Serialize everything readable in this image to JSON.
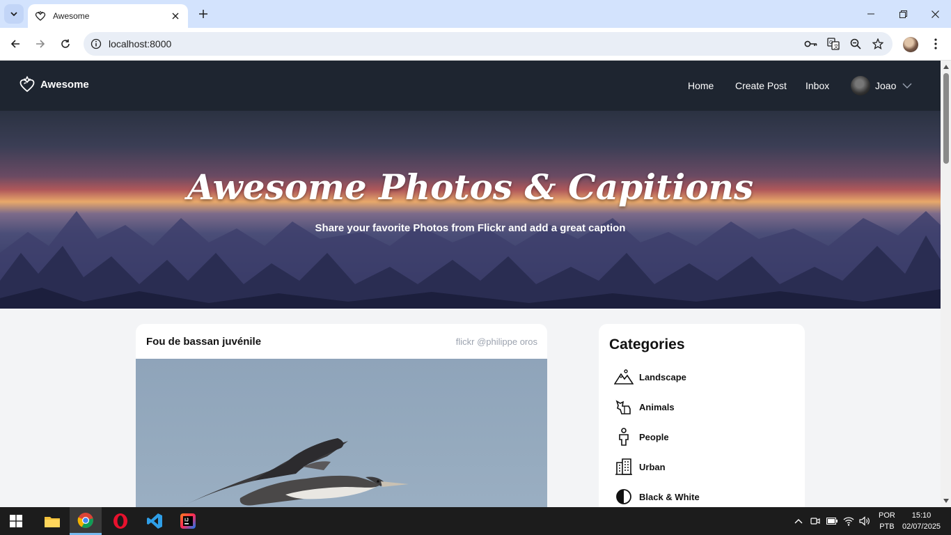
{
  "browser": {
    "tab_title": "Awesome",
    "url": "localhost:8000"
  },
  "navbar": {
    "brand": "Awesome",
    "links": [
      "Home",
      "Create Post",
      "Inbox"
    ],
    "user_name": "Joao"
  },
  "hero": {
    "title": "Awesome Photos & Capitions",
    "subtitle": "Share your favorite Photos from Flickr and add a great caption"
  },
  "post": {
    "title": "Fou de bassan juvénile",
    "credit": "flickr @philippe oros"
  },
  "categories": {
    "title": "Categories",
    "items": [
      {
        "label": "Landscape",
        "icon": "mountain-icon"
      },
      {
        "label": "Animals",
        "icon": "animal-icon"
      },
      {
        "label": "People",
        "icon": "person-icon"
      },
      {
        "label": "Urban",
        "icon": "building-icon"
      },
      {
        "label": "Black & White",
        "icon": "contrast-icon"
      }
    ]
  },
  "taskbar": {
    "lang_top": "POR",
    "lang_bottom": "PTB",
    "time": "15:10",
    "date": "02/07/2025"
  },
  "colors": {
    "navbar_bg": "#1e2530",
    "tabstrip_bg": "#d3e3fd",
    "page_bg": "#f3f4f6"
  }
}
